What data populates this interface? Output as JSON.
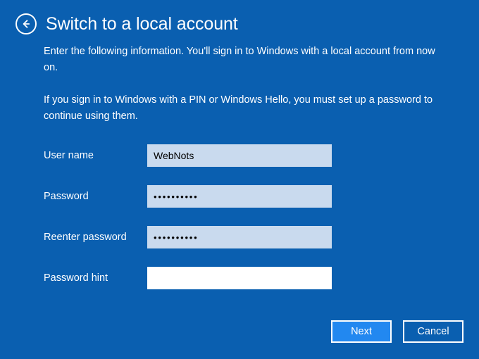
{
  "window": {
    "background_color": "#0a5fb0",
    "text_color": "#ffffff"
  },
  "header": {
    "back_icon": "back-arrow-circle-icon",
    "title": "Switch to a local account"
  },
  "intro": {
    "paragraph1": "Enter the following information. You'll sign in to Windows with a local account from now on.",
    "paragraph2": "If you sign in to Windows with a PIN or Windows Hello, you must set up a password to continue using them."
  },
  "form": {
    "fields": [
      {
        "label": "User name",
        "value": "WebNots",
        "placeholder": "",
        "type": "text",
        "focused": false
      },
      {
        "label": "Password",
        "value": "••••••••••",
        "placeholder": "",
        "type": "password",
        "focused": false
      },
      {
        "label": "Reenter password",
        "value": "••••••••••",
        "placeholder": "",
        "type": "password",
        "focused": false
      },
      {
        "label": "Password hint",
        "value": "",
        "placeholder": "",
        "type": "text",
        "focused": true
      }
    ],
    "input_fill_color": "#c9daee",
    "input_focused_fill_color": "#ffffff"
  },
  "buttons": {
    "next_label": "Next",
    "cancel_label": "Cancel",
    "next_fill_color": "#2288f0"
  }
}
